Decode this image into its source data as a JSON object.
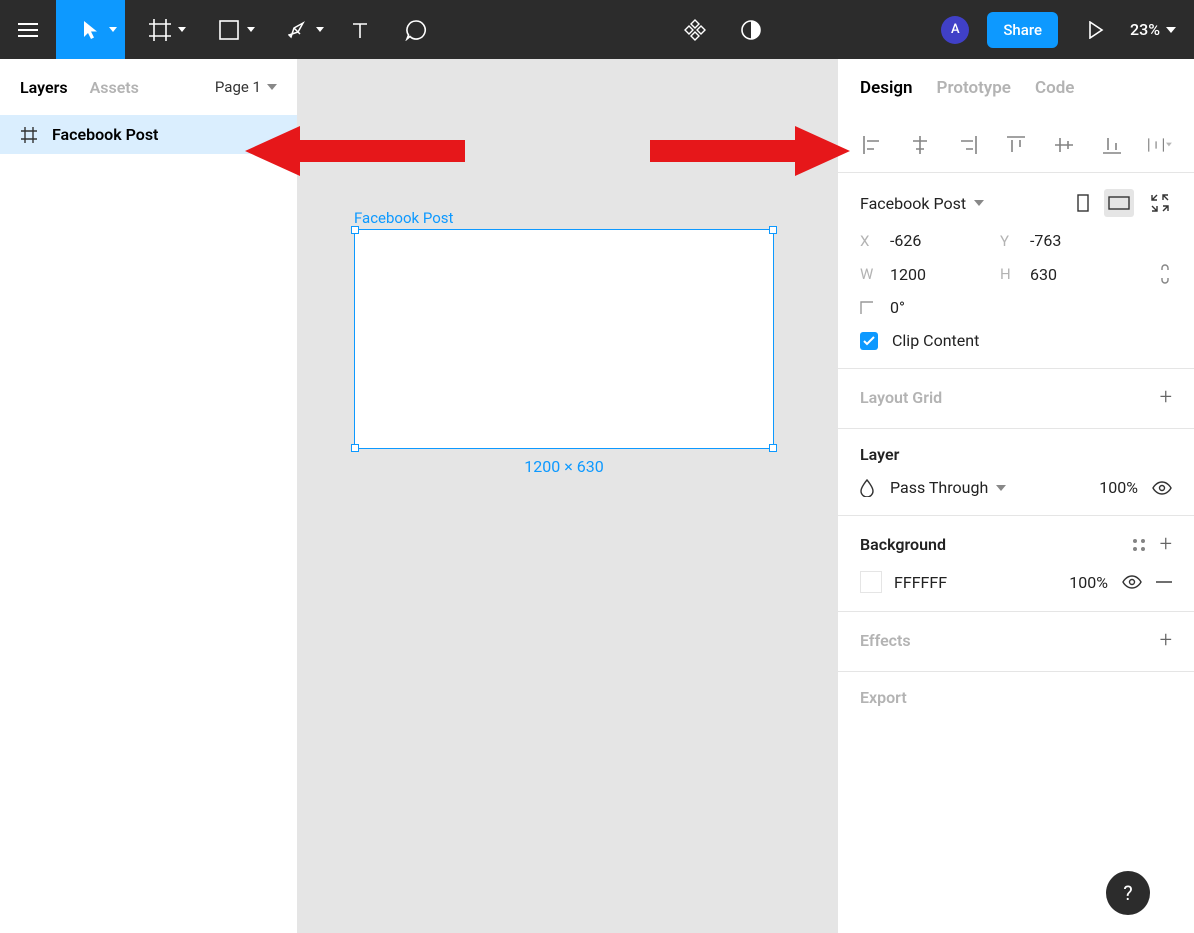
{
  "toolbar": {
    "avatar_initial": "A",
    "share_label": "Share",
    "zoom_label": "23%"
  },
  "left_panel": {
    "tabs": {
      "layers": "Layers",
      "assets": "Assets"
    },
    "page_selector": "Page 1",
    "layer_name": "Facebook Post"
  },
  "canvas": {
    "frame_label": "Facebook Post",
    "dim_label": "1200 × 630"
  },
  "right_panel": {
    "tabs": {
      "design": "Design",
      "prototype": "Prototype",
      "code": "Code"
    },
    "frame_name": "Facebook Post",
    "x": "-626",
    "y": "-763",
    "w": "1200",
    "h": "630",
    "rotation": "0°",
    "clip_content_label": "Clip Content",
    "layout_grid_title": "Layout Grid",
    "layer_title": "Layer",
    "blend_mode": "Pass Through",
    "layer_opacity": "100%",
    "background_title": "Background",
    "bg_hex": "FFFFFF",
    "bg_opacity": "100%",
    "effects_title": "Effects",
    "export_title": "Export",
    "field_labels": {
      "x": "X",
      "y": "Y",
      "w": "W",
      "h": "H"
    }
  }
}
